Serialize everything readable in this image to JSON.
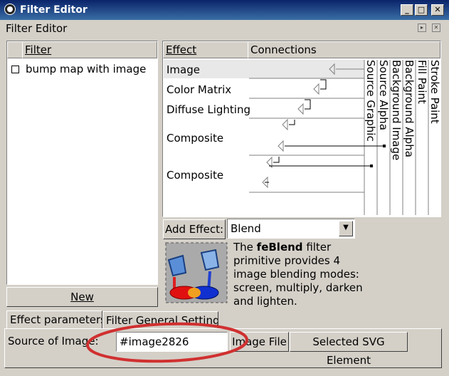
{
  "window": {
    "title": "Filter Editor"
  },
  "dock": {
    "title": "Filter Editor"
  },
  "filter_list": {
    "header": "Filter",
    "items": [
      {
        "label": "bump map with image",
        "checked": false
      }
    ],
    "new_button": "New"
  },
  "effects": {
    "header_effect": "Effect",
    "header_connections": "Connections",
    "items": [
      "Image",
      "Color Matrix",
      "Diffuse Lighting",
      "Composite",
      "Composite"
    ],
    "selected_index": 0,
    "inputs": [
      "Source Graphic",
      "Source Alpha",
      "Background Image",
      "Background Alpha",
      "Fill Paint",
      "Stroke Paint"
    ]
  },
  "add_effect": {
    "button": "Add Effect:",
    "selected": "Blend"
  },
  "description": {
    "pre": "The ",
    "bold": "feBlend",
    "post": " filter primitive provides 4 image blending modes: screen, multiply, darken and lighten."
  },
  "tabs": {
    "effect_parameters": "Effect parameters",
    "general_settings": "Filter General Settings"
  },
  "params": {
    "source_label": "Source of Image:",
    "source_value": "#image2826",
    "image_file_button": "Image File",
    "selected_svg_button": "Selected SVG Element"
  },
  "colors": {
    "title_start": "#0a246a",
    "title_end": "#3a6ea5",
    "selected_row": "#e8e8e8",
    "annotation": "#d03030"
  }
}
